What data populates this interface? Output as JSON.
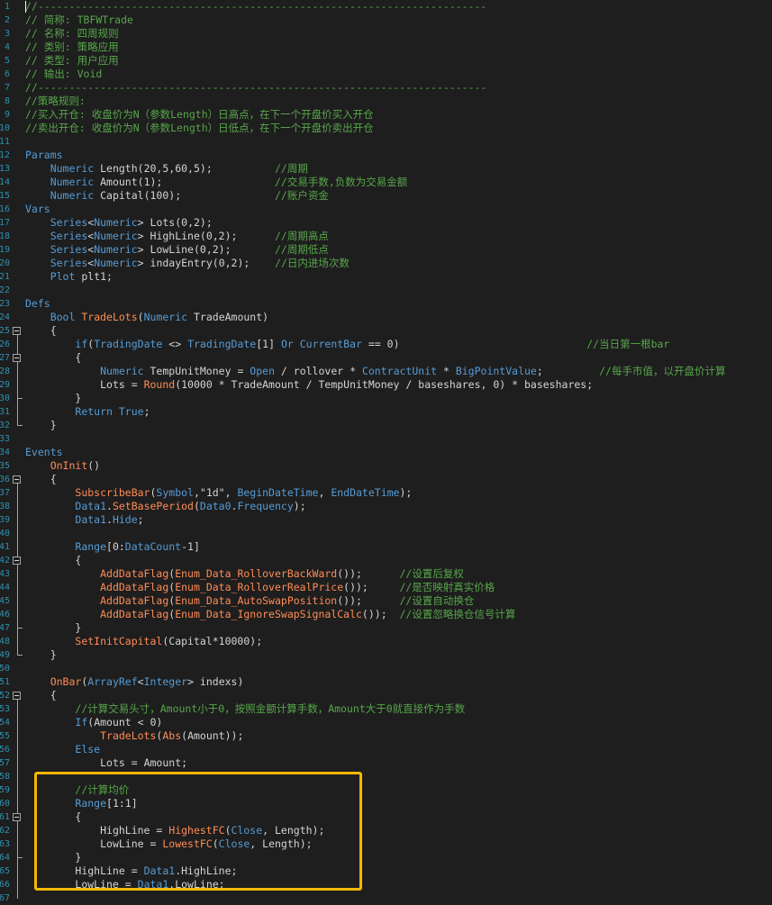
{
  "editor": {
    "highlight_color": "#f5b800",
    "line_numbers": [
      "1",
      "2",
      "3",
      "4",
      "5",
      "6",
      "7",
      "8",
      "9",
      "10",
      "11",
      "12",
      "13",
      "14",
      "15",
      "16",
      "17",
      "18",
      "19",
      "20",
      "21",
      "22",
      "23",
      "24",
      "25",
      "26",
      "27",
      "28",
      "29",
      "30",
      "31",
      "32",
      "33",
      "34",
      "35",
      "36",
      "37",
      "38",
      "39",
      "40",
      "41",
      "42",
      "43",
      "44",
      "45",
      "46",
      "47",
      "48",
      "49",
      "50",
      "51",
      "52",
      "53",
      "54",
      "55",
      "56",
      "57",
      "58",
      "59",
      "60",
      "61",
      "62",
      "63",
      "64",
      "65",
      "66",
      "67"
    ],
    "lines": [
      "//------------------------------------------------------------------------",
      "// 简称: TBFWTrade",
      "// 名称: 四周规则",
      "// 类别: 策略应用",
      "// 类型: 用户应用",
      "// 输出: Void",
      "//------------------------------------------------------------------------",
      "//策略规则:",
      "//买入开仓: 收盘价为N（参数Length）日高点，在下一个开盘价买入开仓",
      "//卖出开仓: 收盘价为N（参数Length）日低点，在下一个开盘价卖出开仓",
      "",
      "Params",
      "    Numeric Length(20,5,60,5);          //周期",
      "    Numeric Amount(1);                  //交易手数,负数为交易金额",
      "    Numeric Capital(100);               //账户资金",
      "Vars",
      "    Series<Numeric> Lots(0,2);",
      "    Series<Numeric> HighLine(0,2);      //周期高点",
      "    Series<Numeric> LowLine(0,2);       //周期低点",
      "    Series<Numeric> indayEntry(0,2);    //日内进场次数",
      "    Plot plt1;",
      "",
      "Defs",
      "    Bool TradeLots(Numeric TradeAmount)",
      "    {",
      "        if(TradingDate <> TradingDate[1] Or CurrentBar == 0)                              //当日第一根bar",
      "        {",
      "            Numeric TempUnitMoney = Open / rollover * ContractUnit * BigPointValue;         //每手市值，以开盘价计算",
      "            Lots = Round(10000 * TradeAmount / TempUnitMoney / baseshares, 0) * baseshares;",
      "        }",
      "        Return True;",
      "    }",
      "",
      "Events",
      "    OnInit()",
      "    {",
      "        SubscribeBar(Symbol,\"1d\", BeginDateTime, EndDateTime);",
      "        Data1.SetBasePeriod(Data0.Frequency);",
      "        Data1.Hide;",
      "",
      "        Range[0:DataCount-1]",
      "        {",
      "            AddDataFlag(Enum_Data_RolloverBackWard());      //设置后复权",
      "            AddDataFlag(Enum_Data_RolloverRealPrice());     //是否映射真实价格",
      "            AddDataFlag(Enum_Data_AutoSwapPosition());      //设置自动换仓",
      "            AddDataFlag(Enum_Data_IgnoreSwapSignalCalc());  //设置忽略换仓信号计算",
      "        }",
      "        SetInitCapital(Capital*10000);",
      "    }",
      "",
      "    OnBar(ArrayRef<Integer> indexs)",
      "    {",
      "        //计算交易头寸，Amount小于0，按照金额计算手数，Amount大于0就直接作为手数",
      "        If(Amount < 0)",
      "            TradeLots(Abs(Amount));",
      "        Else",
      "            Lots = Amount;",
      "",
      "        //计算均价",
      "        Range[1:1]",
      "        {",
      "            HighLine = HighestFC(Close, Length);",
      "            LowLine = LowestFC(Close, Length);",
      "        }",
      "        HighLine = Data1.HighLine;",
      "        LowLine = Data1.LowLine;",
      ""
    ]
  }
}
